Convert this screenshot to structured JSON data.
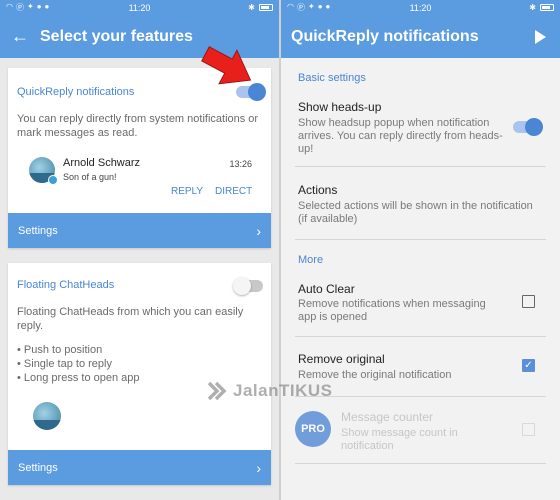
{
  "status": {
    "time": "11:20"
  },
  "left": {
    "title": "Select your features",
    "quickreply": {
      "title": "QuickReply notifications",
      "description": "You can reply directly from system notifications or mark messages as read.",
      "sender": "Arnold Schwarz",
      "message": "Son of a gun!",
      "time": "13:26",
      "reply": "REPLY",
      "direct": "DIRECT",
      "settings": "Settings",
      "enabled": true
    },
    "chatheads": {
      "title": "Floating ChatHeads",
      "description": "Floating ChatHeads from which you can easily reply.",
      "bullet1": "• Push to position",
      "bullet2": "• Single tap to reply",
      "bullet3": "• Long press to open app",
      "settings": "Settings",
      "enabled": false
    }
  },
  "right": {
    "title": "QuickReply notifications",
    "basic_header": "Basic settings",
    "headsup_title": "Show heads-up",
    "headsup_summary": "Show headsup popup when notification arrives. You can reply directly from heads-up!",
    "headsup_enabled": true,
    "actions_title": "Actions",
    "actions_summary": "Selected actions will be shown in the notification (if available)",
    "more_header": "More",
    "autoclear_title": "Auto Clear",
    "autoclear_summary": "Remove notifications when messaging app is opened",
    "autoclear_checked": false,
    "remove_title": "Remove original",
    "remove_summary": "Remove the original notification",
    "remove_checked": true,
    "counter_title": "Message counter",
    "counter_summary": "Show message count in notification",
    "pro_label": "PRO"
  },
  "watermark": "JalanTIKUS",
  "colors": {
    "primary": "#5b9be0",
    "accent": "#4a86d4",
    "arrow": "#e8201c"
  }
}
